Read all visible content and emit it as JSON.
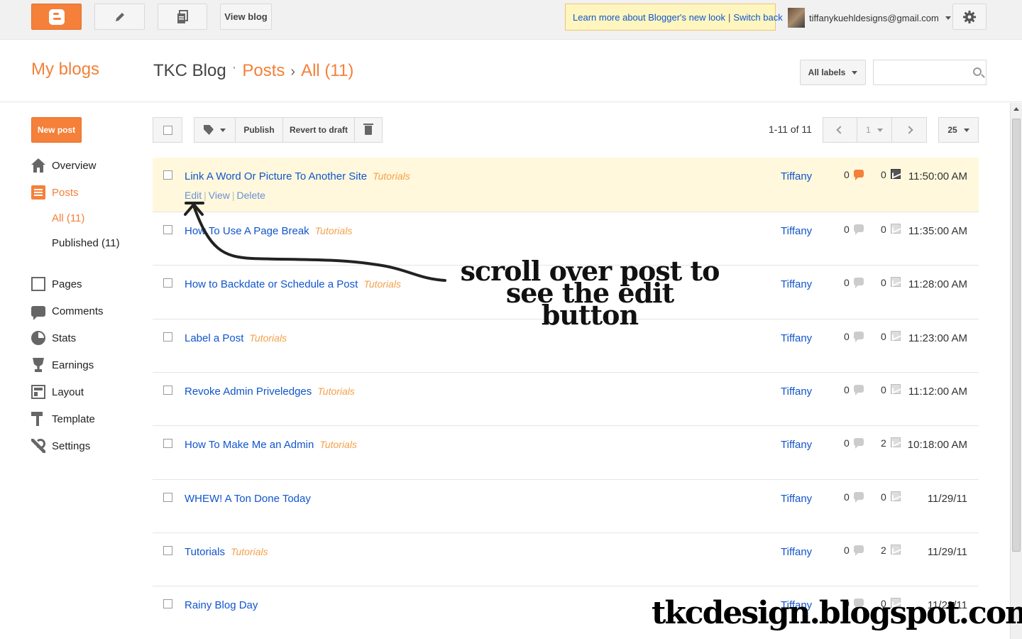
{
  "topbar": {
    "view_blog": "View blog",
    "notice_learn": "Learn more about Blogger's new look",
    "notice_sep": "|",
    "notice_switch": "Switch back",
    "user_email": "tiffanykuehldesigns@gmail.com"
  },
  "header": {
    "my_blogs": "My blogs",
    "blog_name": "TKC Blog",
    "crumb_dot": "·",
    "crumb_posts": "Posts",
    "crumb_arrow": "›",
    "crumb_all": "All (11)",
    "labels_dropdown": "All labels",
    "search_placeholder": ""
  },
  "sidebar": {
    "new_post": "New post",
    "items": [
      {
        "label": "Overview",
        "icon": "home-icon"
      },
      {
        "label": "Posts",
        "icon": "posts-icon"
      },
      {
        "label": "Pages",
        "icon": "pages-icon"
      },
      {
        "label": "Comments",
        "icon": "comments-icon"
      },
      {
        "label": "Stats",
        "icon": "stats-icon"
      },
      {
        "label": "Earnings",
        "icon": "trophy-icon"
      },
      {
        "label": "Layout",
        "icon": "layout-icon"
      },
      {
        "label": "Template",
        "icon": "paint-roller-icon"
      },
      {
        "label": "Settings",
        "icon": "wrench-icon"
      }
    ],
    "sub_all": "All (11)",
    "sub_published": "Published (11)"
  },
  "toolbar": {
    "publish": "Publish",
    "revert": "Revert to draft",
    "range": "1-11 of 11",
    "page": "1",
    "per_page": "25"
  },
  "row_actions": {
    "edit": "Edit",
    "sep": "|",
    "view": "View",
    "delete": "Delete"
  },
  "posts": [
    {
      "title": "Link A Word Or Picture To Another Site",
      "label": "Tutorials",
      "author": "Tiffany",
      "comments": "0",
      "views": "0",
      "time": "11:50:00 AM"
    },
    {
      "title": "How To Use A Page Break",
      "label": "Tutorials",
      "author": "Tiffany",
      "comments": "0",
      "views": "0",
      "time": "11:35:00 AM"
    },
    {
      "title": "How to Backdate or Schedule a Post",
      "label": "Tutorials",
      "author": "Tiffany",
      "comments": "0",
      "views": "0",
      "time": "11:28:00 AM"
    },
    {
      "title": "Label a Post",
      "label": "Tutorials",
      "author": "Tiffany",
      "comments": "0",
      "views": "0",
      "time": "11:23:00 AM"
    },
    {
      "title": "Revoke Admin Priveledges",
      "label": "Tutorials",
      "author": "Tiffany",
      "comments": "0",
      "views": "0",
      "time": "11:12:00 AM"
    },
    {
      "title": "How To Make Me an Admin",
      "label": "Tutorials",
      "author": "Tiffany",
      "comments": "0",
      "views": "2",
      "time": "10:18:00 AM"
    },
    {
      "title": "WHEW! A Ton Done Today",
      "label": "",
      "author": "Tiffany",
      "comments": "0",
      "views": "0",
      "time": "11/29/11"
    },
    {
      "title": "Tutorials",
      "label": "Tutorials",
      "author": "Tiffany",
      "comments": "0",
      "views": "2",
      "time": "11/29/11"
    },
    {
      "title": "Rainy Blog Day",
      "label": "",
      "author": "Tiffany",
      "comments": "0",
      "views": "0",
      "time": "11/28/11"
    }
  ],
  "annotation": {
    "line1": "scroll over post to",
    "line2": "see the edit button"
  },
  "watermark": "tkcdesign.blogspot.com",
  "colors": {
    "accent": "#f4803a",
    "link": "#1155cc",
    "label": "#f4a04a",
    "hover_row": "#fff8dc",
    "notice_bg": "#fff6bf"
  }
}
